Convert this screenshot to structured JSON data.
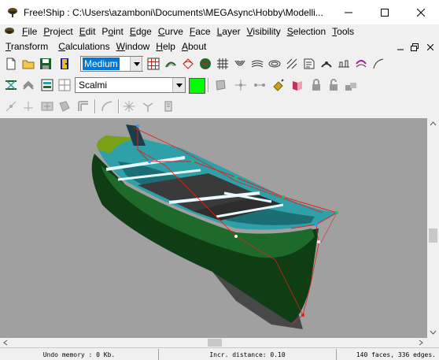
{
  "window": {
    "title": "Free!Ship  : C:\\Users\\azamboni\\Documents\\MEGAsync\\Hobby\\Modelli..."
  },
  "menu": {
    "row1": [
      {
        "label": "File",
        "accel": "F"
      },
      {
        "label": "Project",
        "accel": "P"
      },
      {
        "label": "Edit",
        "accel": "E"
      },
      {
        "label": "Point",
        "accel": "o"
      },
      {
        "label": "Edge",
        "accel": "E"
      },
      {
        "label": "Curve",
        "accel": "C"
      },
      {
        "label": "Face",
        "accel": "F"
      },
      {
        "label": "Layer",
        "accel": "L"
      },
      {
        "label": "Visibility",
        "accel": "V"
      },
      {
        "label": "Selection",
        "accel": "S"
      },
      {
        "label": "Tools",
        "accel": "T"
      }
    ],
    "row2": [
      {
        "label": "Transform",
        "accel": "T"
      },
      {
        "label": "Calculations",
        "accel": "C"
      },
      {
        "label": "Window",
        "accel": "W"
      },
      {
        "label": "Help",
        "accel": "H"
      },
      {
        "label": "About",
        "accel": "A"
      }
    ]
  },
  "toolbar": {
    "precision_value": "Medium",
    "layer_value": "Scalmi",
    "layer_color": "#00ff00"
  },
  "status": {
    "undo_memory": "Undo memory : 0 Kb.",
    "incr_distance": "Incr. distance: 0.10",
    "geometry_count": "140 faces, 336 edges."
  },
  "colors": {
    "viewport_bg": "#a0a0a0",
    "hull_dark": "#0f3d14",
    "hull_mid": "#1e6a2a",
    "interior": "#2fa0a8",
    "highlight": "#e8f8ff",
    "control_net": "#e02020",
    "shadow": "#4a4a4a"
  }
}
